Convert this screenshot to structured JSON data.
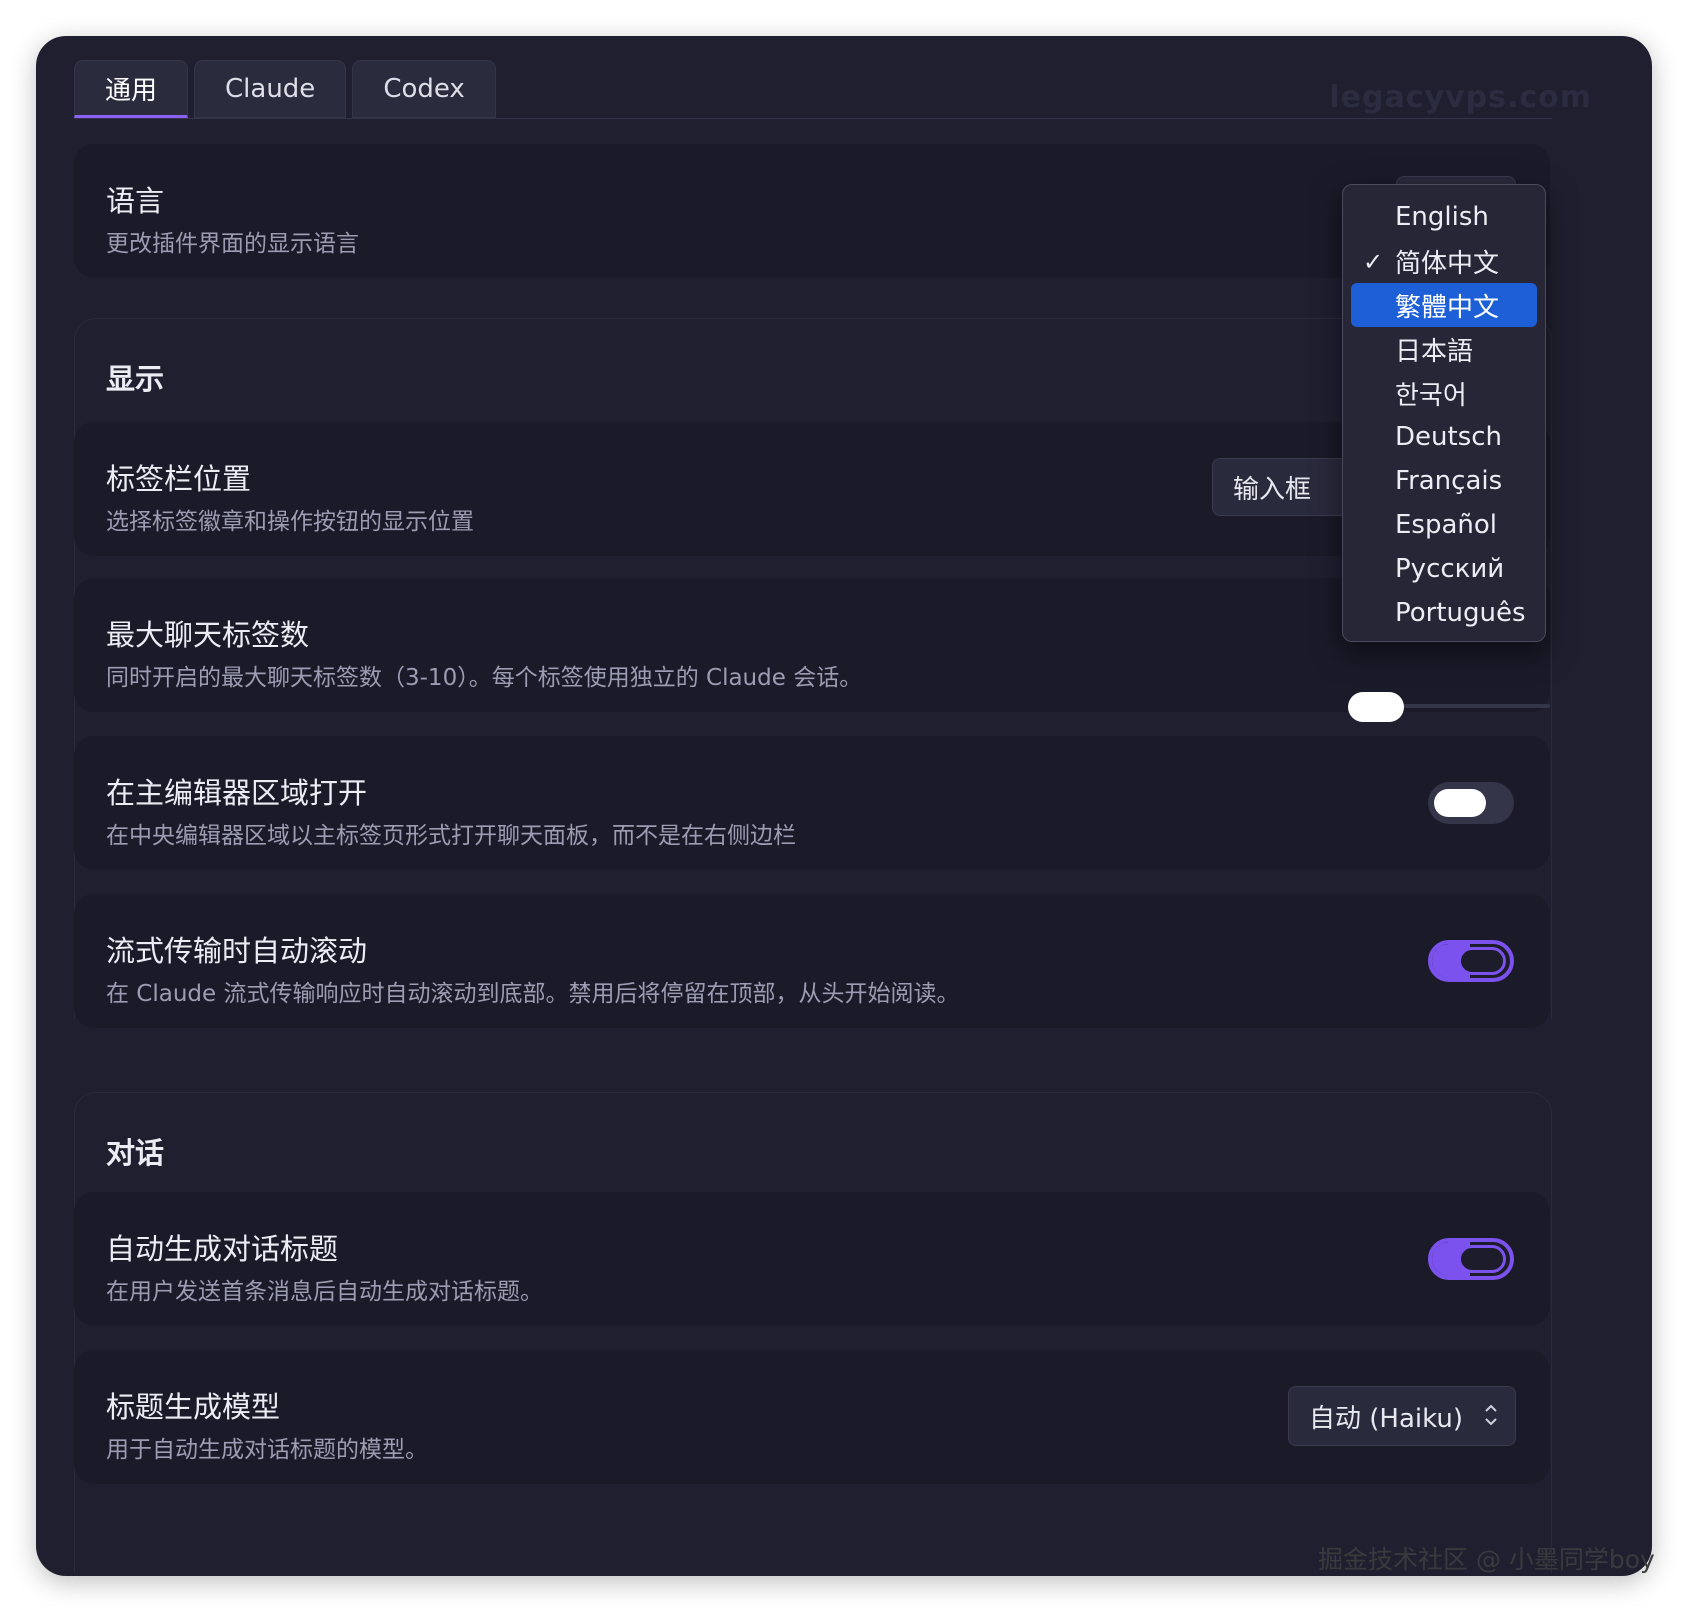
{
  "tabs": [
    {
      "label": "通用",
      "active": true
    },
    {
      "label": "Claude",
      "active": false
    },
    {
      "label": "Codex",
      "active": false
    }
  ],
  "watermark_top": "legacyvps.com",
  "language": {
    "title": "语言",
    "description": "更改插件界面的显示语言"
  },
  "display_section": {
    "title": "显示",
    "tab_bar_position": {
      "title": "标签栏位置",
      "description": "选择标签徽章和操作按钮的显示位置",
      "value": "输入框"
    },
    "max_tabs": {
      "title": "最大聊天标签数",
      "description": "同时开启的最大聊天标签数（3-10）。每个标签使用独立的 Claude 会话。",
      "slider_fraction": 0.0
    },
    "open_in_editor": {
      "title": "在主编辑器区域打开",
      "description": "在中央编辑器区域以主标签页形式打开聊天面板，而不是在右侧边栏",
      "enabled": false
    },
    "auto_scroll": {
      "title": "流式传输时自动滚动",
      "description": "在 Claude 流式传输响应时自动滚动到底部。禁用后将停留在顶部，从头开始阅读。",
      "enabled": true
    }
  },
  "conversation_section": {
    "title": "对话",
    "auto_title": {
      "title": "自动生成对话标题",
      "description": "在用户发送首条消息后自动生成对话标题。",
      "enabled": true
    },
    "title_model": {
      "title": "标题生成模型",
      "description": "用于自动生成对话标题的模型。",
      "value": "自动 (Haiku)"
    }
  },
  "language_dropdown": {
    "options": [
      "English",
      "简体中文",
      "繁體中文",
      "日本語",
      "한국어",
      "Deutsch",
      "Français",
      "Español",
      "Русский",
      "Português"
    ],
    "selected": "简体中文",
    "highlighted": "繁體中文",
    "check_glyph": "✓"
  },
  "watermark_bottom": "掘金技术社区 @ 小墨同学boy",
  "colors": {
    "accent": "#7c52ee",
    "highlight": "#1d5fd6",
    "background": "#1f1f30"
  }
}
